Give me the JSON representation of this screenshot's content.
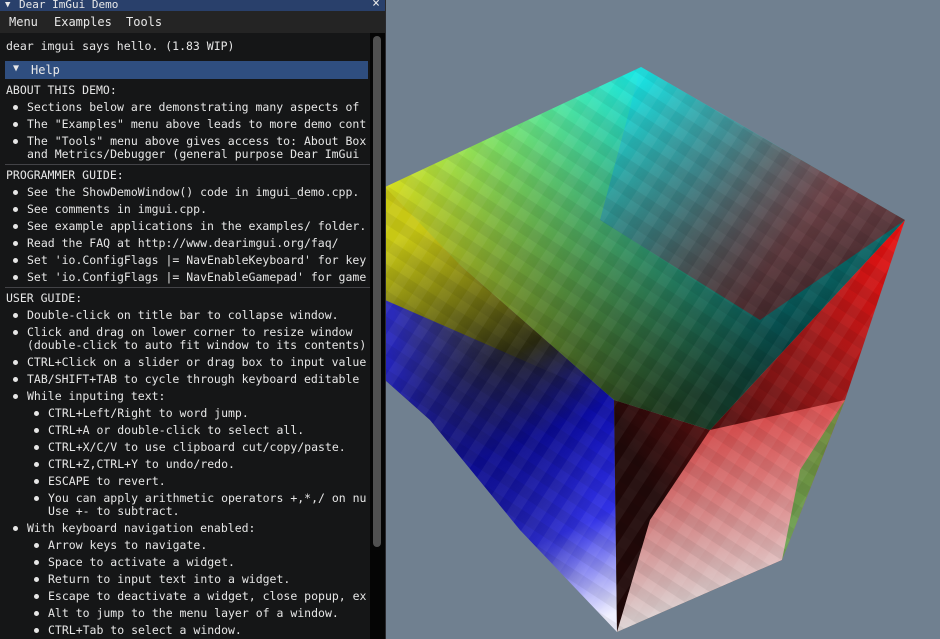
{
  "window": {
    "title": "Dear ImGui Demo",
    "collapse_glyph": "▼",
    "close_glyph": "×"
  },
  "menubar": {
    "items": [
      "Menu",
      "Examples",
      "Tools"
    ]
  },
  "hello_text": "dear imgui says hello. (1.83 WIP)",
  "help_header": {
    "arrow": "▼",
    "label": "Help"
  },
  "about": {
    "heading": "ABOUT THIS DEMO:",
    "items": [
      "Sections below are demonstrating many aspects of",
      "The \"Examples\" menu above leads to more demo cont",
      "The \"Tools\" menu above gives access to: About Box",
      "and Metrics/Debugger (general purpose Dear ImGui"
    ]
  },
  "programmer": {
    "heading": "PROGRAMMER GUIDE:",
    "items": [
      "See the ShowDemoWindow() code in imgui_demo.cpp.",
      "See comments in imgui.cpp.",
      "See example applications in the examples/ folder.",
      "Read the FAQ at http://www.dearimgui.org/faq/",
      "Set 'io.ConfigFlags |= NavEnableKeyboard' for key",
      "Set 'io.ConfigFlags |= NavEnableGamepad' for game"
    ]
  },
  "user": {
    "heading": "USER GUIDE:",
    "items": [
      "Double-click on title bar to collapse window.",
      "Click and drag on lower corner to resize window",
      "(double-click to auto fit window to its contents)",
      "CTRL+Click on a slider or drag box to input value",
      "TAB/SHIFT+TAB to cycle through keyboard editable",
      "While inputing text:"
    ],
    "text_items": [
      "CTRL+Left/Right to word jump.",
      "CTRL+A or double-click to select all.",
      "CTRL+X/C/V to use clipboard cut/copy/paste.",
      "CTRL+Z,CTRL+Y to undo/redo.",
      "ESCAPE to revert.",
      "You can apply arithmetic operators +,*,/ on nu",
      "Use +- to subtract."
    ],
    "nav_heading": "With keyboard navigation enabled:",
    "nav_items": [
      "Arrow keys to navigate.",
      "Space to activate a widget.",
      "Return to input text into a widget.",
      "Escape to deactivate a widget, close popup, ex",
      "Alt to jump to the menu layer of a window.",
      "CTRL+Tab to select a window."
    ]
  },
  "colors": {
    "background": "#708090",
    "title_bar": "#29406b",
    "header": "#2f4e7f",
    "window_bg": "#0f0f0f"
  }
}
